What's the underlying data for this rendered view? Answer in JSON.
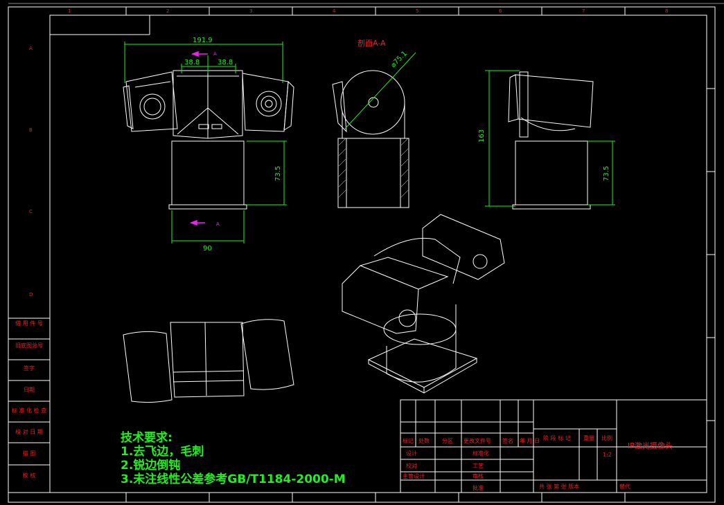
{
  "drawing": {
    "section_label": "剖面A-A",
    "dims": {
      "overall_width": "191.9",
      "half_left": "38.8",
      "half_right": "38.8",
      "base_height_front": "73.5",
      "base_width": "90",
      "section_dia": "⌀75.1",
      "side_height": "163",
      "side_base_height": "73.5"
    },
    "section_markers": {
      "top": "A",
      "bottom": "A"
    },
    "border_cols": [
      "1",
      "2",
      "3",
      "4",
      "5",
      "6",
      "7",
      "8"
    ],
    "border_rows": [
      "A",
      "B",
      "C",
      "D"
    ]
  },
  "tech_notes": {
    "title": "技术要求:",
    "lines": [
      "1.去飞边，毛刺",
      "2.锐边倒钝",
      "3.未注线性公差参考GB/T1184-2000-M"
    ]
  },
  "left_column": [
    "借 用 件 号",
    "旧底图总号",
    "签字",
    "日期",
    "标 准 化 检 查",
    "校 对 日 期",
    "描 图",
    "校 核"
  ],
  "title_block": {
    "row1": [
      "标记",
      "处数",
      "分区",
      "更改文件号",
      "签名",
      "年 月 日"
    ],
    "rows": [
      [
        "设计",
        "",
        "",
        "标准化"
      ],
      [
        "校对",
        "",
        "",
        "工艺"
      ],
      [
        "主管设计",
        "",
        "",
        "审核"
      ]
    ],
    "approve": "批准",
    "stage_headers": [
      "阶 段 标 记",
      "重量",
      "比例"
    ],
    "scale": "1:2",
    "sheets": "共 张 第 张 版本",
    "replace": "替代",
    "product_name": "IP激光摄像头"
  },
  "colors": {
    "line": "#ffffff",
    "dim": "#22ee22",
    "text_red": "#ee2222",
    "marker": "#ee22ee"
  }
}
